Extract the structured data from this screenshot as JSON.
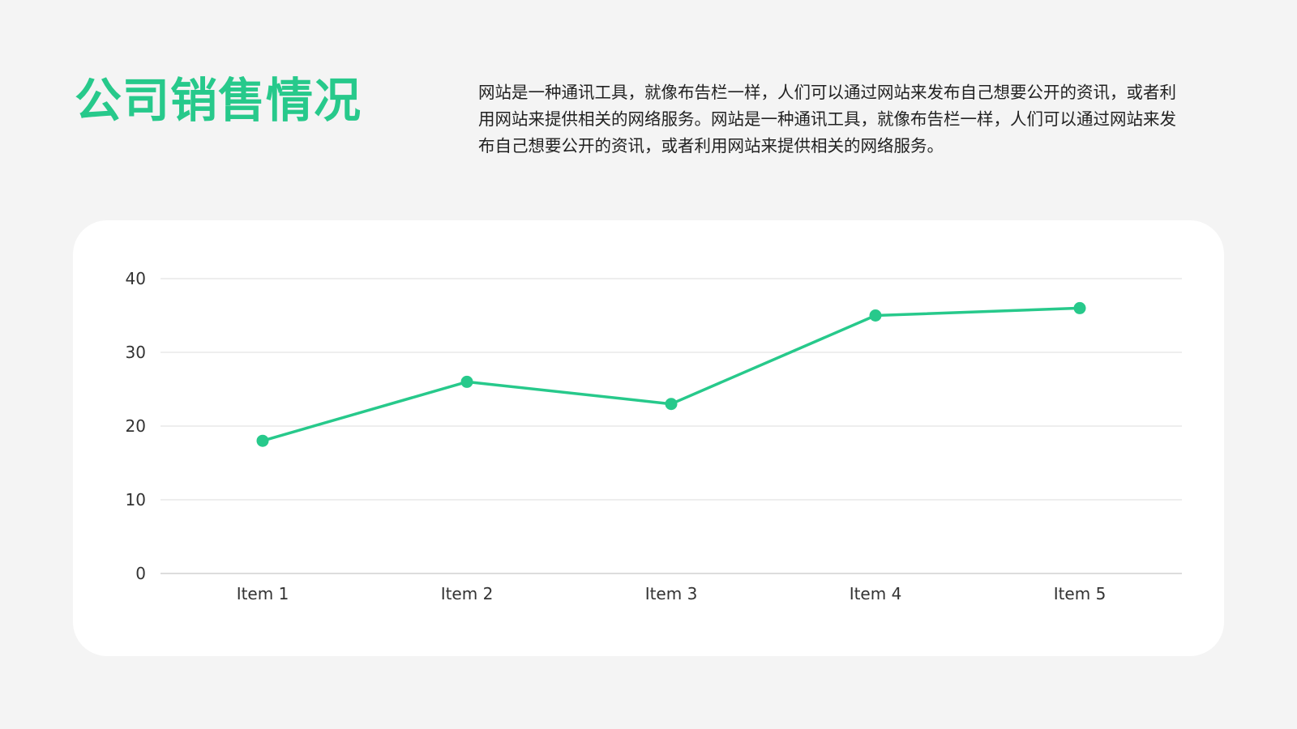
{
  "header": {
    "title": "公司销售情况",
    "description": "网站是一种通讯工具，就像布告栏一样，人们可以通过网站来发布自己想要公开的资讯，或者利用网站来提供相关的网络服务。网站是一种通讯工具，就像布告栏一样，人们可以通过网站来发布自己想要公开的资讯，或者利用网站来提供相关的网络服务。"
  },
  "colors": {
    "accent": "#27c98b",
    "background": "#f4f4f4",
    "card": "#ffffff",
    "gridline": "#dddddd",
    "baseline": "#bbbbbb"
  },
  "chart_data": {
    "type": "line",
    "categories": [
      "Item 1",
      "Item 2",
      "Item 3",
      "Item 4",
      "Item 5"
    ],
    "series": [
      {
        "values": [
          18,
          26,
          23,
          35,
          36
        ]
      }
    ],
    "yticks": [
      "0",
      "10",
      "20",
      "30",
      "40"
    ],
    "ylim": [
      0,
      40
    ],
    "grid": true,
    "legend": "none",
    "markers": true
  }
}
